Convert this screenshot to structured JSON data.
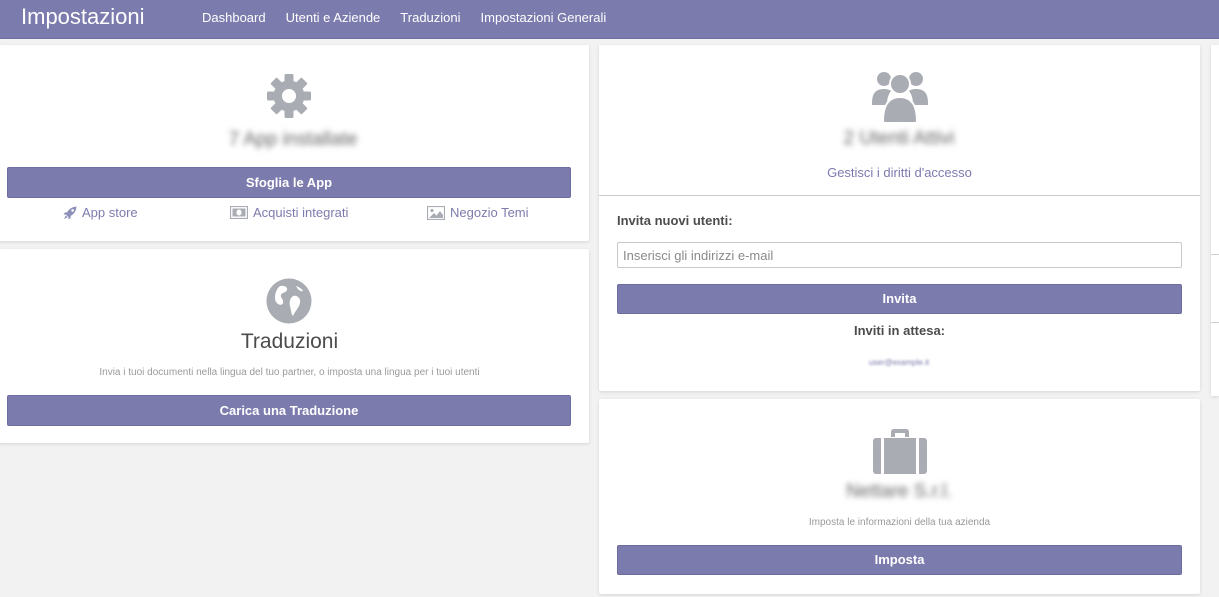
{
  "app": {
    "title": "Impostazioni"
  },
  "nav": {
    "items": [
      "Dashboard",
      "Utenti e Aziende",
      "Traduzioni",
      "Impostazioni Generali"
    ]
  },
  "apps_card": {
    "installed_text": "7 App installate",
    "browse_button": "Sfoglia le App",
    "links": [
      {
        "label": "App store",
        "icon": "rocket-icon"
      },
      {
        "label": "Acquisti integrati",
        "icon": "money-icon"
      },
      {
        "label": "Negozio Temi",
        "icon": "picture-icon"
      }
    ]
  },
  "translations_card": {
    "title": "Traduzioni",
    "description": "Invia i tuoi documenti nella lingua del tuo partner, o imposta una lingua per i tuoi utenti",
    "button": "Carica una Traduzione"
  },
  "users_card": {
    "active_users_text": "2 Utenti Attivi",
    "access_link": "Gestisci i diritti d'accesso",
    "invite_label": "Invita nuovi utenti:",
    "email_placeholder": "Inserisci gli indirizzi e-mail",
    "invite_button": "Invita",
    "pending_label": "Inviti in attesa:",
    "pending_email": "user@example.it"
  },
  "company_card": {
    "company_name": "Nettare S.r.l.",
    "description": "Imposta le informazioni della tua azienda",
    "button": "Imposta"
  },
  "colors": {
    "accent": "#7c7bad",
    "icon_gray": "#a9adb3",
    "background": "#f2f2f2"
  }
}
